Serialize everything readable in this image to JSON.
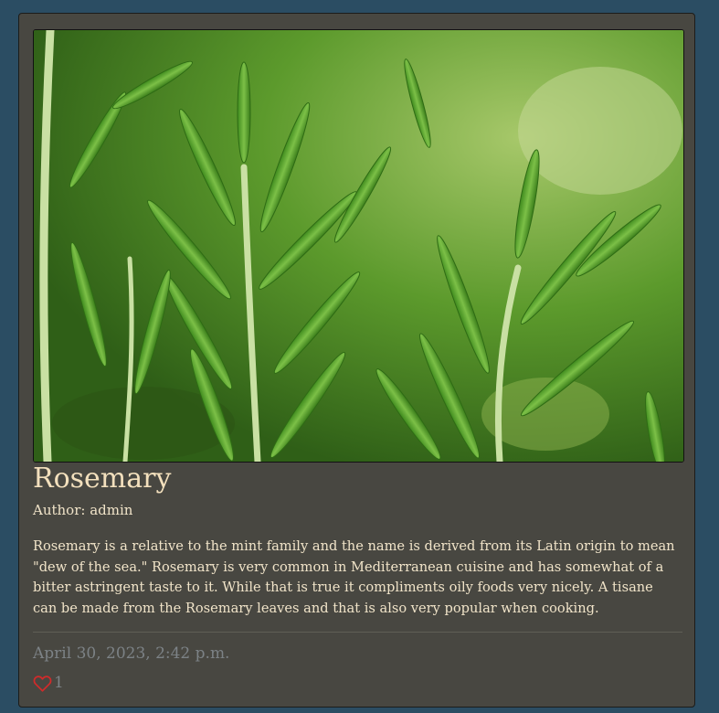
{
  "post": {
    "image_alt": "Rosemary",
    "title": "Rosemary",
    "author": "Author: admin",
    "body": "Rosemary is a relative to the mint family and the name is derived from its Latin origin to mean \"dew of the sea.\" Rosemary is very common in Mediterranean cuisine and has somewhat of a bitter astringent taste to it. While that is true it compliments oily foods very nicely. A tisane can be made from the Rosemary leaves and that is also very popular when cooking.",
    "date": "April 30, 2023, 2:42 p.m.",
    "like_count": "1",
    "like_icon": "heart-icon"
  },
  "colors": {
    "page_bg": "#2b4d63",
    "card_bg": "#484741",
    "title": "#f3e0bd",
    "text": "#f1e4c9",
    "muted": "#7c8286",
    "heart": "#d22a2a"
  }
}
